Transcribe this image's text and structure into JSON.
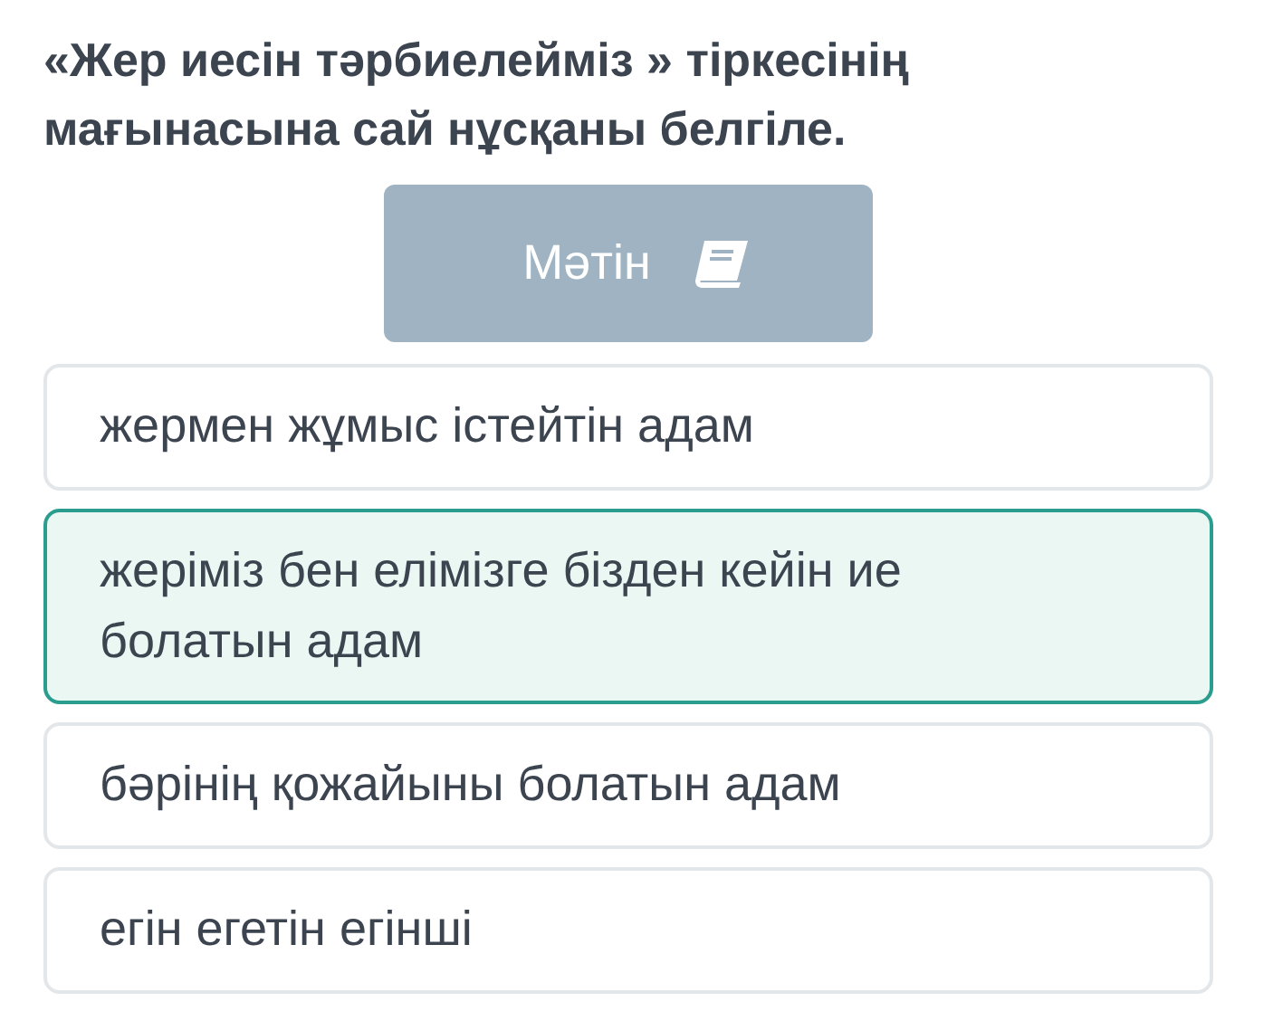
{
  "question": "«Жер иесін тәрбиелейміз » тіркесінің мағынасына сай нұсқаны белгіле.",
  "text_button": {
    "label": "Мәтін"
  },
  "options": [
    {
      "label": "жермен жұмыс істейтін адам",
      "selected": false
    },
    {
      "label": "жеріміз бен елімізге бізден кейін ие болатын адам",
      "selected": true
    },
    {
      "label": "бәрінің қожайыны болатын адам",
      "selected": false
    },
    {
      "label": "егін егетін егінші",
      "selected": false
    }
  ]
}
